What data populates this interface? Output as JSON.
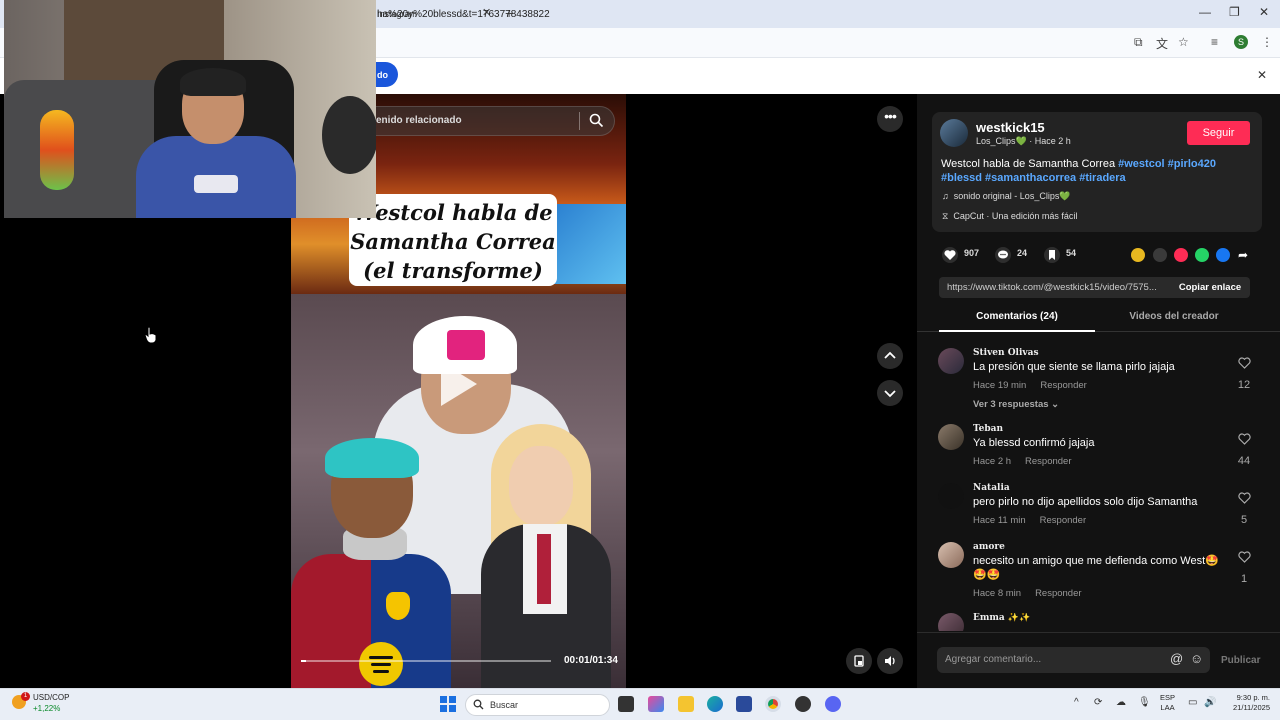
{
  "browser": {
    "tab_title": "Instagram",
    "url": "ha%20y%20blessd&t=1763778438822",
    "infobar_button": "do"
  },
  "video": {
    "search_text": "enido relacionado",
    "caption_line1": "Westcol habla de",
    "caption_line2": "Samantha Correa",
    "caption_line3": "(el transforme)",
    "time": "00:01/01:34",
    "progress_fraction": 0.02
  },
  "post": {
    "author": "westkick15",
    "author_sub": "Los_Clips💚 · Hace 2 h",
    "follow_label": "Seguir",
    "desc_text": "Westcol habla de Samantha Correa ",
    "hashtags": [
      "#westcol",
      "#pirlo420",
      "#blessd",
      "#samanthacorrea",
      "#tiradera"
    ],
    "sound": "sonido original - Los_Clips💚",
    "capcut": "CapCut · Una edición más fácil",
    "likes": "907",
    "comments": "24",
    "saves": "54",
    "link": "https://www.tiktok.com/@westkick15/video/7575...",
    "copy_label": "Copiar enlace"
  },
  "tabs": {
    "comments_label": "Comentarios (24)",
    "videos_label": "Videos del creador"
  },
  "comments": [
    {
      "user": "Stiven Olivas",
      "text": "La presión que siente se llama pirlo jajaja",
      "time": "Hace 19 min",
      "reply": "Responder",
      "likes": "12",
      "more": "Ver 3 respuestas"
    },
    {
      "user": "Teban",
      "text": "Ya blessd confirmó jajaja",
      "time": "Hace 2 h",
      "reply": "Responder",
      "likes": "44"
    },
    {
      "user": "Natalia",
      "text": "pero pirlo no dijo apellidos solo dijo Samantha",
      "time": "Hace 11 min",
      "reply": "Responder",
      "likes": "5"
    },
    {
      "user": "amore",
      "text": "necesito un amigo que me defienda como West🤩 🤩🤩",
      "time": "Hace 8 min",
      "reply": "Responder",
      "likes": "1"
    },
    {
      "user": "Emma ✨✨",
      "text": "",
      "time": "",
      "reply": "",
      "likes": ""
    }
  ],
  "composer": {
    "placeholder": "Agregar comentario...",
    "publish": "Publicar"
  },
  "taskbar": {
    "stock_name": "USD/COP",
    "stock_change": "+1,22%",
    "stock_badge": "1",
    "search": "Buscar",
    "lang1": "ESP",
    "lang2": "LAA",
    "time": "9:30 p. m.",
    "date": "21/11/2025"
  },
  "colors": {
    "accent": "#fe2c55",
    "hashtag": "#5aa8ff",
    "panel_bg": "#121212"
  }
}
